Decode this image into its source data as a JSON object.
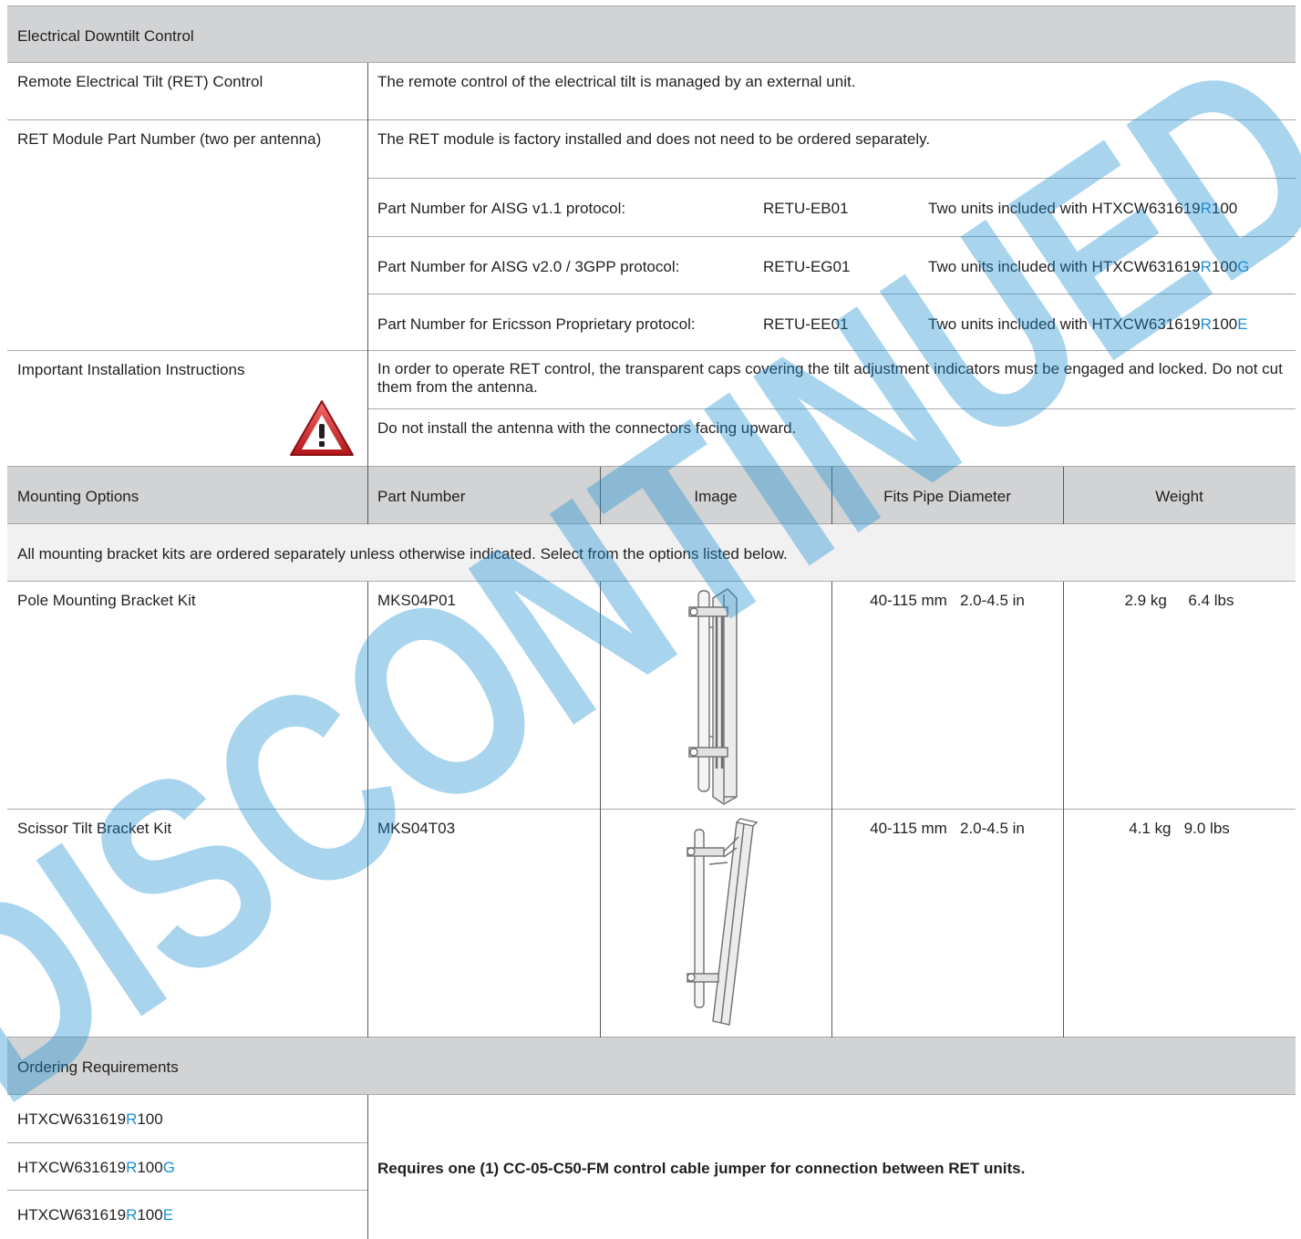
{
  "sections": {
    "edt_title": "Electrical Downtilt Control",
    "mounting_title": "Mounting Options",
    "ordering_title": "Ordering Requirements"
  },
  "ret": {
    "label": "Remote Electrical Tilt (RET) Control",
    "text": "The remote control of the electrical tilt is managed by an external unit."
  },
  "module": {
    "label": "RET Module Part Number (two per antenna)",
    "text": "The RET module is factory installed and does not need to be ordered separately.",
    "parts": [
      {
        "desc": "Part Number for AISG v1.1 protocol:",
        "pn": "RETU-EB01",
        "note_prefix": "Two units included with HTXCW631619",
        "r": "R",
        "mid": "100",
        "suffix": ""
      },
      {
        "desc": "Part Number for AISG v2.0 / 3GPP protocol:",
        "pn": "RETU-EG01",
        "note_prefix": "Two units included with HTXCW631619",
        "r": "R",
        "mid": "100",
        "suffix": "G"
      },
      {
        "desc": "Part Number for Ericsson Proprietary protocol:",
        "pn": "RETU-EE01",
        "note_prefix": "Two units included with HTXCW631619",
        "r": "R",
        "mid": "100",
        "suffix": "E"
      }
    ]
  },
  "install": {
    "label": "Important Installation Instructions",
    "text1": "In order to operate RET control, the transparent caps covering the tilt adjustment indicators must be engaged and locked.  Do not cut them from the antenna.",
    "text2": "Do not install the antenna with the connectors facing upward.",
    "warning_icon": "warning-triangle-icon"
  },
  "mounting": {
    "headers": [
      "Part Number",
      "Image",
      "Fits Pipe Diameter",
      "Weight"
    ],
    "note": "All mounting bracket kits are ordered separately unless otherwise indicated.  Select from the options listed below.",
    "kits": [
      {
        "name": "Pole Mounting Bracket Kit",
        "pn": "MKS04P01",
        "pipe": "40-115 mm   2.0-4.5 in",
        "weight": "2.9 kg     6.4 lbs"
      },
      {
        "name": "Scissor Tilt Bracket Kit",
        "pn": "MKS04T03",
        "pipe": "40-115 mm   2.0-4.5 in",
        "weight": "4.1 kg   9.0 lbs"
      }
    ]
  },
  "ordering": {
    "models": [
      {
        "base": "HTXCW631619",
        "r": "R",
        "mid": "100",
        "suffix": ""
      },
      {
        "base": "HTXCW631619",
        "r": "R",
        "mid": "100",
        "suffix": "G"
      },
      {
        "base": "HTXCW631619",
        "r": "R",
        "mid": "100",
        "suffix": "E"
      }
    ],
    "requirement": "Requires one (1) CC-05-C50-FM control cable jumper for connection between RET units."
  },
  "watermark": "DISCONTINUED",
  "colors": {
    "accent": "#1a8fd2",
    "header_gray": "#d1d3d4",
    "warning_red": "#d9262b"
  }
}
